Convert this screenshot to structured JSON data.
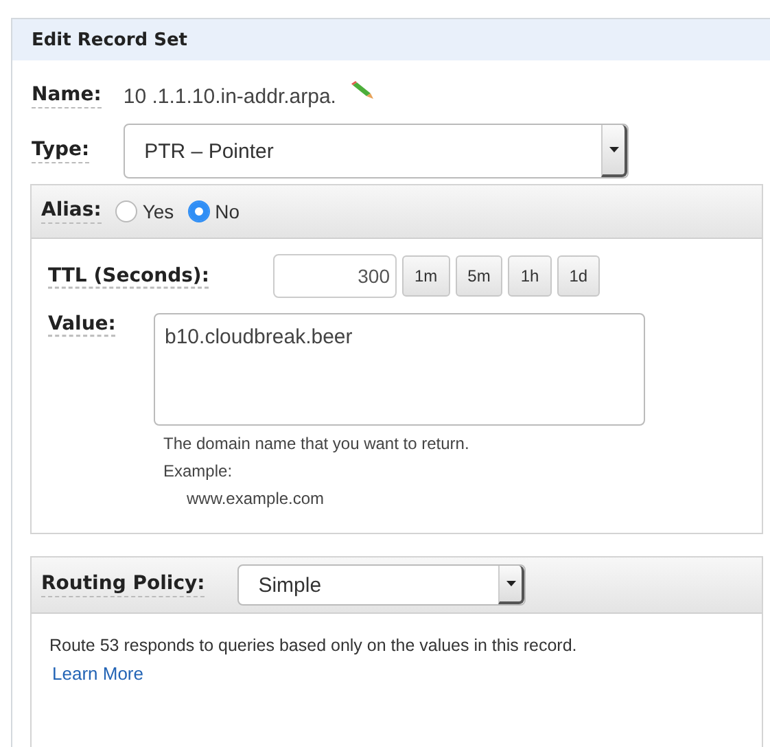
{
  "panel": {
    "title": "Edit Record Set"
  },
  "name": {
    "label": "Name:",
    "value": "10 .1.1.10.in-addr.arpa."
  },
  "type": {
    "label": "Type:",
    "value": "PTR – Pointer"
  },
  "alias": {
    "label": "Alias:",
    "options": [
      {
        "label": "Yes",
        "selected": false
      },
      {
        "label": "No",
        "selected": true
      }
    ]
  },
  "ttl": {
    "label": "TTL (Seconds):",
    "value": "300",
    "presets": [
      "1m",
      "5m",
      "1h",
      "1d"
    ]
  },
  "value": {
    "label": "Value:",
    "value": "b10.cloudbreak.beer",
    "help": "The domain name that you want to return.",
    "example_label": "Example:",
    "example": "www.example.com"
  },
  "routing": {
    "label": "Routing Policy:",
    "value": "Simple",
    "description": "Route 53 responds to queries based only on the values in this record.",
    "link": "Learn More"
  }
}
